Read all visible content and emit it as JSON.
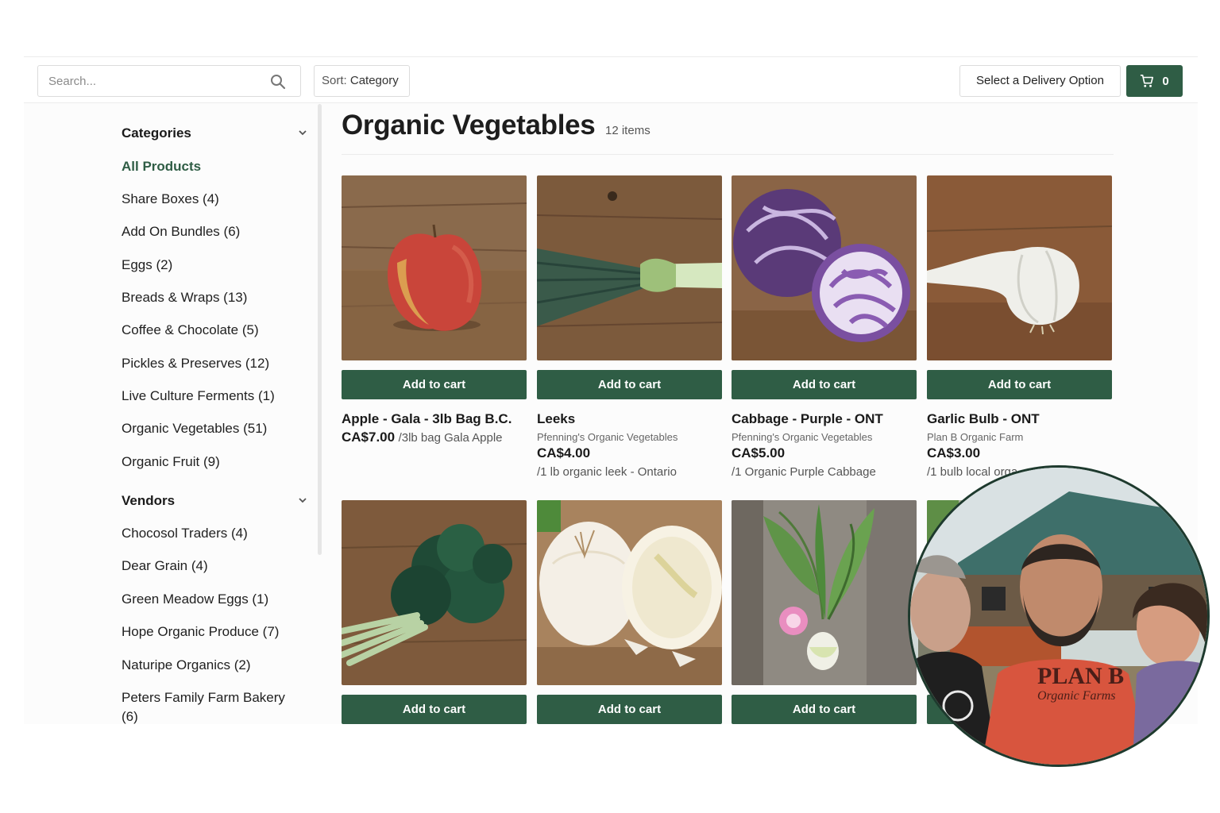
{
  "header": {
    "search_placeholder": "Search...",
    "sort_prefix": "Sort:",
    "sort_value": "Category",
    "delivery_label": "Select a Delivery Option",
    "cart_count": "0"
  },
  "sidebar": {
    "categories_title": "Categories",
    "categories": [
      {
        "label": "All Products",
        "active": true
      },
      {
        "label": "Share Boxes (4)"
      },
      {
        "label": "Add On Bundles (6)"
      },
      {
        "label": "Eggs (2)"
      },
      {
        "label": "Breads & Wraps (13)"
      },
      {
        "label": "Coffee & Chocolate (5)"
      },
      {
        "label": "Pickles & Preserves (12)"
      },
      {
        "label": "Live Culture Ferments (1)"
      },
      {
        "label": "Organic Vegetables (51)"
      },
      {
        "label": "Organic Fruit (9)"
      }
    ],
    "vendors_title": "Vendors",
    "vendors": [
      {
        "label": "Chocosol Traders (4)"
      },
      {
        "label": "Dear Grain (4)"
      },
      {
        "label": "Green Meadow Eggs (1)"
      },
      {
        "label": "Hope Organic Produce (7)"
      },
      {
        "label": "Naturipe Organics (2)"
      },
      {
        "label": "Peters Family Farm Bakery (6)"
      }
    ]
  },
  "main": {
    "title": "Organic Vegetables",
    "count": "12 items",
    "add_label": "Add to cart",
    "products": [
      {
        "name": "Apple - Gala - 3lb Bag B.C.",
        "vendor": "",
        "price": "CA$7.00",
        "unit": "/3lb bag Gala Apple",
        "desc": "",
        "photo": "apple"
      },
      {
        "name": "Leeks",
        "vendor": "Pfenning's Organic Vegetables",
        "price": "CA$4.00",
        "unit": "",
        "desc": "/1 lb organic leek - Ontario",
        "photo": "leek"
      },
      {
        "name": "Cabbage - Purple - ONT",
        "vendor": "Pfenning's Organic Vegetables",
        "price": "CA$5.00",
        "unit": "",
        "desc": "/1 Organic Purple Cabbage",
        "photo": "cabbage"
      },
      {
        "name": "Garlic Bulb - ONT",
        "vendor": "Plan B Organic Farm",
        "price": "CA$3.00",
        "unit": "",
        "desc": "/1 bulb local orga",
        "photo": "garlic"
      },
      {
        "photo": "kale"
      },
      {
        "photo": "onion"
      },
      {
        "photo": "radish"
      },
      {
        "photo": "hidden"
      }
    ]
  },
  "farmers_photo": {
    "shirt_logo_line1": "PLAN B",
    "shirt_logo_line2": "Organic Farms"
  },
  "colors": {
    "brand_green": "#2f5d45",
    "circle_border": "#1e3a2e"
  }
}
